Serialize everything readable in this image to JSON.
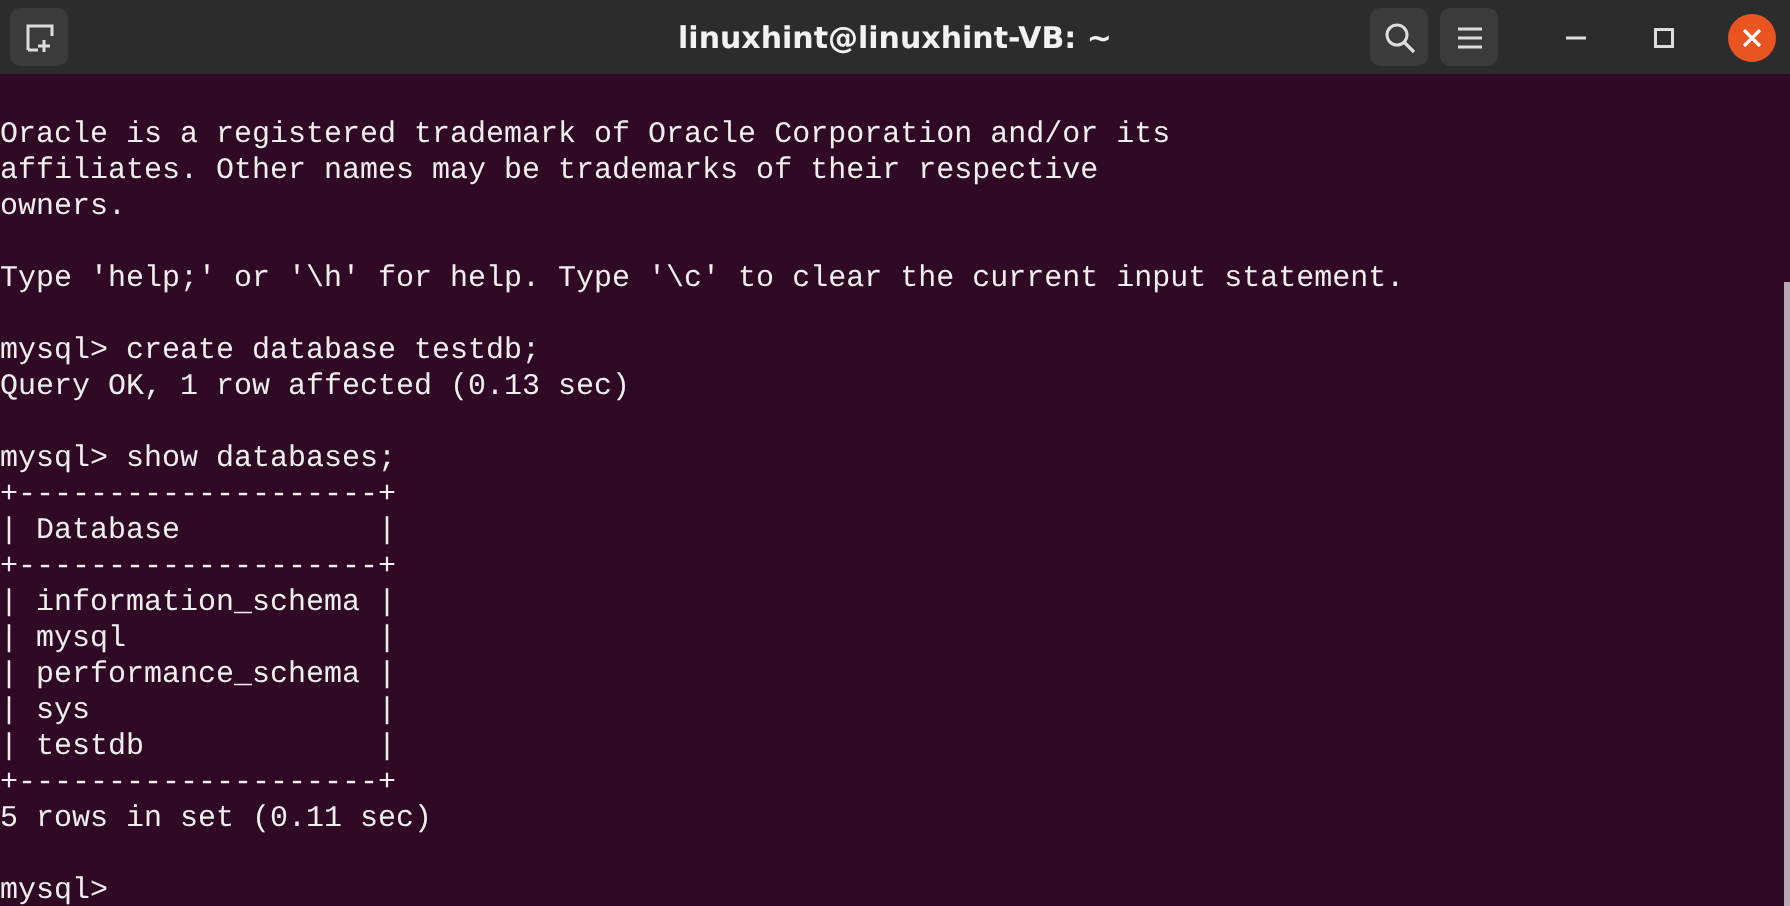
{
  "window": {
    "title": "linuxhint@linuxhint-VB: ~"
  },
  "terminal": {
    "blocks": [
      [
        "Oracle is a registered trademark of Oracle Corporation and/or its",
        "affiliates. Other names may be trademarks of their respective",
        "owners."
      ],
      [
        "Type 'help;' or '\\h' for help. Type '\\c' to clear the current input statement."
      ],
      [
        "mysql> create database testdb;",
        "Query OK, 1 row affected (0.13 sec)"
      ],
      [
        "mysql> show databases;",
        "+--------------------+",
        "| Database           |",
        "+--------------------+",
        "| information_schema |",
        "| mysql              |",
        "| performance_schema |",
        "| sys                |",
        "| testdb             |",
        "+--------------------+",
        "5 rows in set (0.11 sec)"
      ],
      [
        "mysql>"
      ]
    ]
  }
}
